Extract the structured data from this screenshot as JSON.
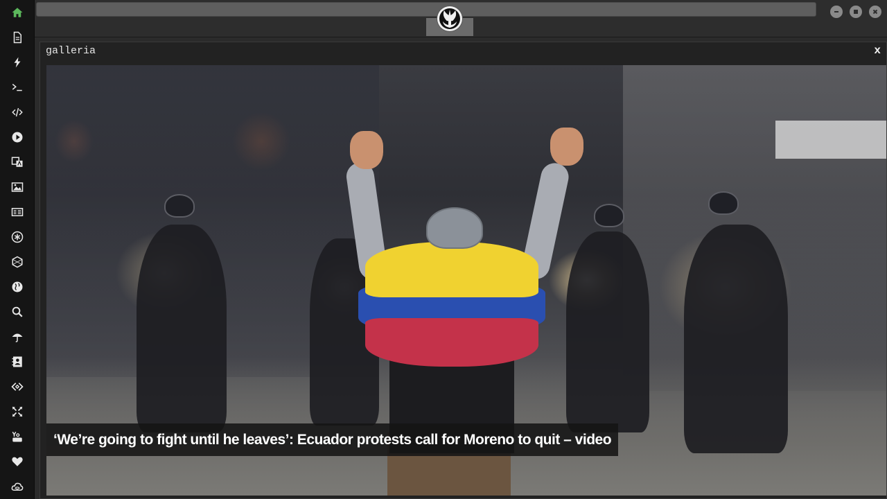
{
  "sidebar": {
    "items": [
      {
        "icon": "home-icon",
        "active": true
      },
      {
        "icon": "document-icon"
      },
      {
        "icon": "lightning-icon"
      },
      {
        "icon": "terminal-icon"
      },
      {
        "icon": "code-icon"
      },
      {
        "icon": "play-icon"
      },
      {
        "icon": "translate-icon"
      },
      {
        "icon": "image-icon"
      },
      {
        "icon": "newspaper-icon"
      },
      {
        "icon": "asterisk-icon"
      },
      {
        "icon": "hexagon-icon"
      },
      {
        "icon": "globe-icon"
      },
      {
        "icon": "search-icon"
      },
      {
        "icon": "umbrella-icon"
      },
      {
        "icon": "contact-card-icon"
      },
      {
        "icon": "embed-icon"
      },
      {
        "icon": "expand-icon"
      },
      {
        "icon": "youtube-icon"
      },
      {
        "icon": "heart-icon"
      },
      {
        "icon": "cloud-icon"
      }
    ],
    "colors": {
      "active": "#5cb85c",
      "icon": "#e8e8e8"
    }
  },
  "topbar": {
    "logo": "rebel-alliance-logo-icon",
    "window_controls": [
      "minimize-icon",
      "maximize-icon",
      "close-icon"
    ]
  },
  "gallery": {
    "title": "galleria",
    "close_label": "x",
    "caption": "‘We’re going to fight until he leaves’: Ecuador protests call for Moreno to quit – video"
  }
}
